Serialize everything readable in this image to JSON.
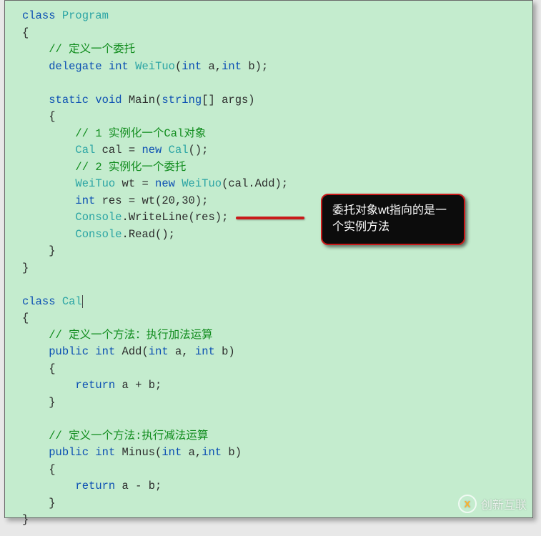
{
  "code": {
    "l1_class": "class",
    "l1_program": "Program",
    "l2": "{",
    "l3_slash": "// ",
    "l3_text": "定义一个委托",
    "l4_delegate": "delegate",
    "l4_int": "int",
    "l4_weituo": "WeiTuo",
    "l4_sig": "(",
    "l4_int2": "int",
    "l4_a": " a,",
    "l4_int3": "int",
    "l4_b": " b);",
    "l6_static": "static",
    "l6_void": "void",
    "l6_main": " Main(",
    "l6_string": "string",
    "l6_args": "[] args)",
    "l7": "{",
    "l8_slash": "// ",
    "l8_text": "1 实例化一个Cal对象",
    "l9_cal": "Cal",
    "l9_eq": " cal = ",
    "l9_new": "new",
    "l9_cal2": " Cal",
    "l9_end": "();",
    "l10_slash": "// ",
    "l10_text": "2 实例化一个委托",
    "l11_weituo": "WeiTuo",
    "l11_eq": " wt = ",
    "l11_new": "new",
    "l11_weituo2": " WeiTuo",
    "l11_args": "(cal.Add);",
    "l12_int": "int",
    "l12_rest": " res = wt(20,30);",
    "l13_console": "Console",
    "l13_rest": ".WriteLine(res);",
    "l14_console": "Console",
    "l14_rest": ".Read();",
    "l15": "}",
    "l16": "}",
    "l18_class": "class",
    "l18_cal": "Cal",
    "l19": "{",
    "l20_slash": "// ",
    "l20_text": "定义一个方法：执行加法运算",
    "l21_public": "public",
    "l21_int": "int",
    "l21_add": " Add(",
    "l21_int2": "int",
    "l21_a": " a, ",
    "l21_int3": "int",
    "l21_b": " b)",
    "l22": "{",
    "l23_return": "return",
    "l23_rest": " a + b;",
    "l24": "}",
    "l26_slash": "// ",
    "l26_text": "定义一个方法:执行减法运算",
    "l27_public": "public",
    "l27_int": "int",
    "l27_minus": " Minus(",
    "l27_int2": "int",
    "l27_a": " a,",
    "l27_int3": "int",
    "l27_b": " b)",
    "l28": "{",
    "l29_return": "return",
    "l29_rest": " a - b;",
    "l30": "}",
    "l31": "}"
  },
  "callout": "委托对象wt指向的是一个实例方法",
  "watermark": "创新互联",
  "watermark_icon": "X"
}
